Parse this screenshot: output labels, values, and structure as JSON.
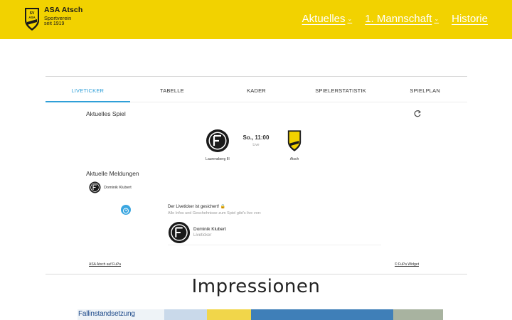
{
  "header": {
    "club_name": "ASA Atsch",
    "club_sub": "Sportverein",
    "club_since": "seit 1919",
    "nav": [
      {
        "label": "Aktuelles",
        "has_dropdown": true
      },
      {
        "label": "1. Mannschaft",
        "has_dropdown": true
      },
      {
        "label": "Historie",
        "has_dropdown": false
      }
    ]
  },
  "widget": {
    "tabs": [
      "LIVETICKER",
      "TABELLE",
      "KADER",
      "SPIELERSTATISTIK",
      "SPIELPLAN"
    ],
    "active_tab": "LIVETICKER",
    "current_game_title": "Aktuelles Spiel",
    "match": {
      "home": "Laurensberg III",
      "away": "Atsch",
      "time": "So., 11:00",
      "status": "Live"
    },
    "reports_title": "Aktuelle Meldungen",
    "reporter_name": "Dominik Klubert",
    "message": {
      "headline": "Der Liveticker ist gesichert! 🔒",
      "description": "Alle Infos und Geschehnisse zum Spiel gibt's live von:",
      "author": "Dominik Klubert",
      "role": "Liveticker"
    },
    "footer_left": "ASA Atsch auf FuPa",
    "footer_right": "© FuPa Widget"
  },
  "section_title": "Impressionen",
  "photo_caption": "Fallinstandsetzung",
  "colors": {
    "header_bg": "#f2d200",
    "accent": "#2f9fd8",
    "nav_text": "#ffffff"
  }
}
